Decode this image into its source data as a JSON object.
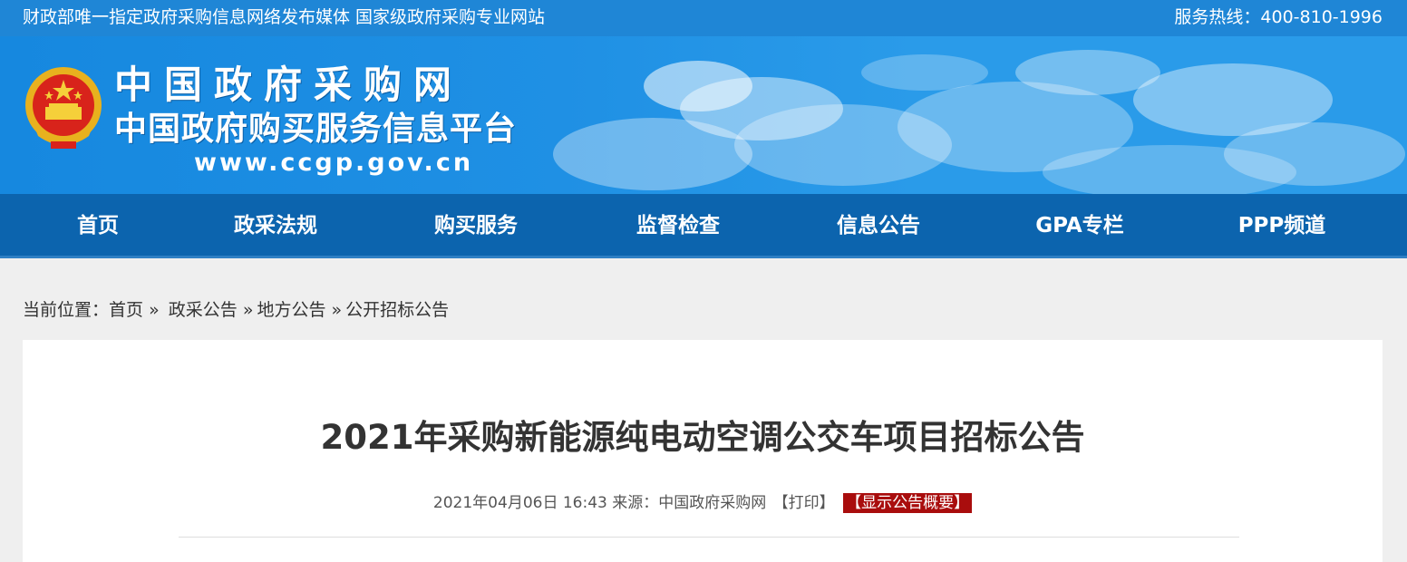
{
  "topbar": {
    "tagline": "财政部唯一指定政府采购信息网络发布媒体 国家级政府采购专业网站",
    "hotline": "服务热线：400-810-1996"
  },
  "header": {
    "logo_line1": "中国政府采购网",
    "logo_line2": "中国政府购买服务信息平台",
    "logo_url": "www.ccgp.gov.cn"
  },
  "nav": {
    "items": [
      {
        "label": "首页"
      },
      {
        "label": "政采法规"
      },
      {
        "label": "购买服务"
      },
      {
        "label": "监督检查"
      },
      {
        "label": "信息公告"
      },
      {
        "label": "GPA专栏"
      },
      {
        "label": "PPP频道"
      }
    ]
  },
  "breadcrumb": {
    "prefix": "当前位置：",
    "items": [
      "首页",
      "政采公告",
      "地方公告",
      "公开招标公告"
    ],
    "separator": "»"
  },
  "article": {
    "title": "2021年采购新能源纯电动空调公交车项目招标公告",
    "datetime": "2021年04月06日 16:43",
    "source_label": "来源：",
    "source": "中国政府采购网",
    "print_label": "【打印】",
    "summary_label": "【显示公告概要】"
  },
  "colors": {
    "topbar": "#1f86d6",
    "nav": "#0c64ae",
    "summary_badge": "#a90d0d"
  }
}
